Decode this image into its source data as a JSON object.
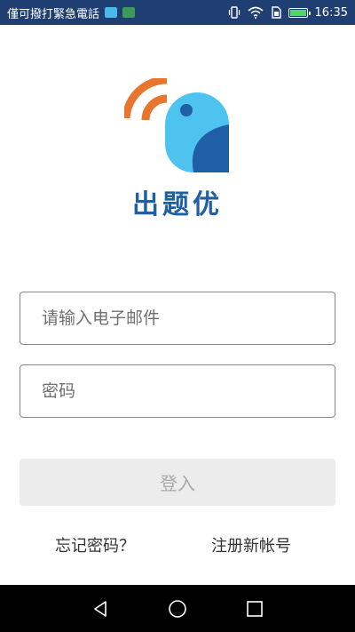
{
  "status_bar": {
    "carrier_text": "僅可撥打緊急電話",
    "time": "16:35",
    "icons": [
      "app-notification-icon",
      "play-store-icon",
      "vibrate-icon",
      "wifi-icon",
      "sim-icon",
      "battery-icon"
    ]
  },
  "app": {
    "brand_name": "出题优",
    "colors": {
      "brand_blue": "#1f5fa6",
      "bird_light_blue": "#4fc3f0",
      "bird_dark_blue": "#1f5fa6",
      "signal_orange": "#e8742e",
      "status_bar": "#1f3f73"
    }
  },
  "login_form": {
    "email_placeholder": "请输入电子邮件",
    "password_placeholder": "密码",
    "login_label": "登入",
    "forgot_password_label": "忘记密码？",
    "register_label": "注册新帐号"
  },
  "nav_bar": {
    "icons": [
      "back-icon",
      "home-icon",
      "recents-icon"
    ]
  }
}
